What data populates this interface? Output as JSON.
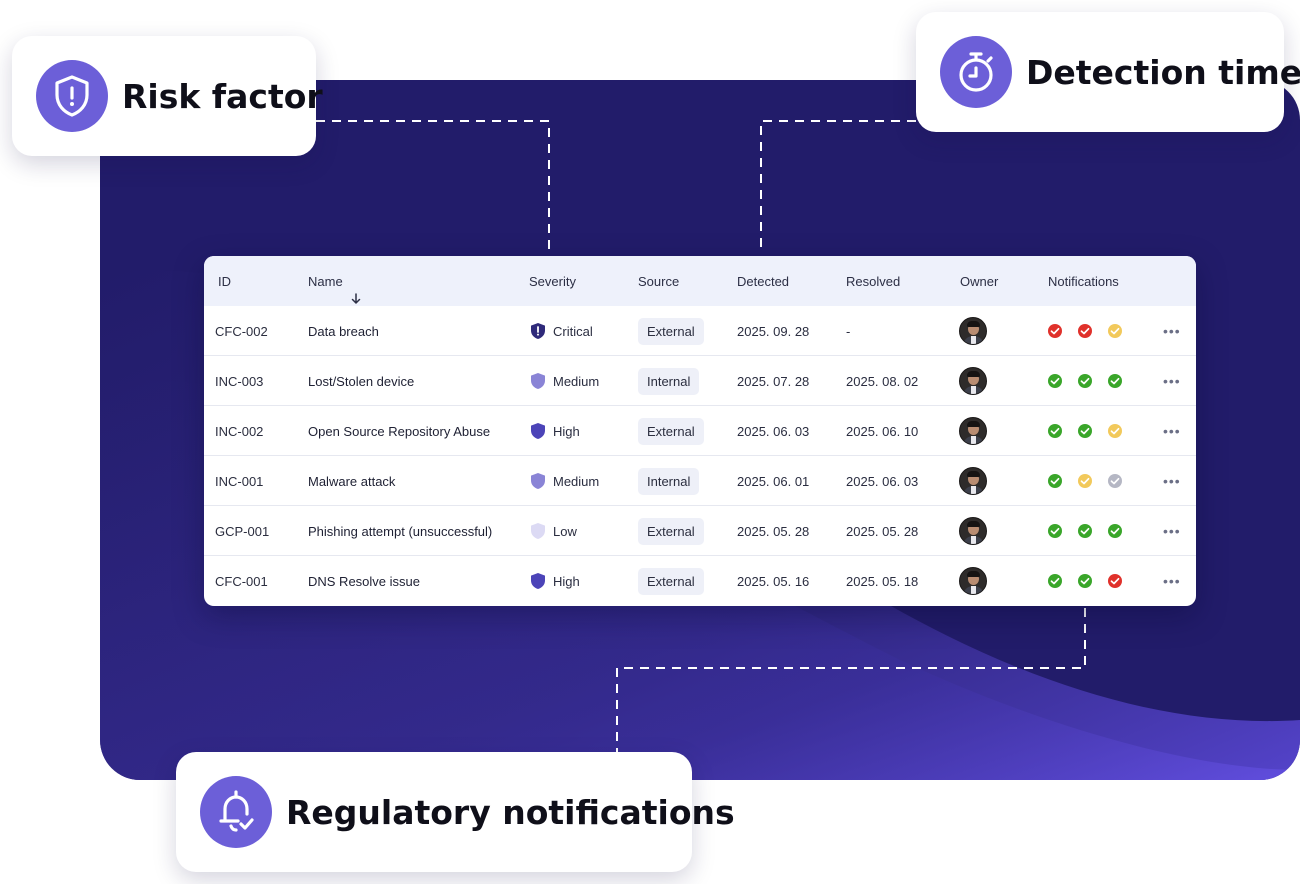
{
  "callouts": {
    "risk_factor": {
      "label": "Risk factor",
      "icon": "shield-alert-icon"
    },
    "detection_time": {
      "label": "Detection time",
      "icon": "stopwatch-icon"
    },
    "regulatory": {
      "label": "Regulatory notifications",
      "icon": "bell-check-icon"
    }
  },
  "colors": {
    "accent": "#6c5fd8",
    "panel": "#221c6a",
    "status_ok": "#3aa62a",
    "status_fail": "#e0312b",
    "status_pending": "#f2c95b",
    "status_unknown": "#b5b7c4"
  },
  "table": {
    "headers": {
      "id": "ID",
      "name": "Name",
      "severity": "Severity",
      "source": "Source",
      "detected": "Detected",
      "resolved": "Resolved",
      "owner": "Owner",
      "notifications": "Notifications"
    },
    "sort": {
      "column": "name",
      "icon": "arrow-down-icon"
    },
    "rows": [
      {
        "id": "CFC-002",
        "name": "Data breach",
        "severity": "Critical",
        "source": "External",
        "detected": "2025. 09. 28",
        "resolved": "-",
        "notifications": [
          "red",
          "red",
          "yellow"
        ]
      },
      {
        "id": "INC-003",
        "name": "Lost/Stolen device",
        "severity": "Medium",
        "source": "Internal",
        "detected": "2025. 07. 28",
        "resolved": "2025. 08. 02",
        "notifications": [
          "green",
          "green",
          "green"
        ]
      },
      {
        "id": "INC-002",
        "name": "Open Source Repository Abuse",
        "severity": "High",
        "source": "External",
        "detected": "2025. 06. 03",
        "resolved": "2025. 06. 10",
        "notifications": [
          "green",
          "green",
          "yellow"
        ]
      },
      {
        "id": "INC-001",
        "name": "Malware attack",
        "severity": "Medium",
        "source": "Internal",
        "detected": "2025. 06. 01",
        "resolved": "2025. 06. 03",
        "notifications": [
          "green",
          "yellow",
          "gray"
        ]
      },
      {
        "id": "GCP-001",
        "name": "Phishing attempt (unsuccessful)",
        "severity": "Low",
        "source": "External",
        "detected": "2025. 05. 28",
        "resolved": "2025. 05. 28",
        "notifications": [
          "green",
          "green",
          "green"
        ]
      },
      {
        "id": "CFC-001",
        "name": "DNS Resolve issue",
        "severity": "High",
        "source": "External",
        "detected": "2025. 05. 16",
        "resolved": "2025. 05. 18",
        "notifications": [
          "green",
          "green",
          "red"
        ]
      }
    ],
    "more_label": "•••"
  }
}
